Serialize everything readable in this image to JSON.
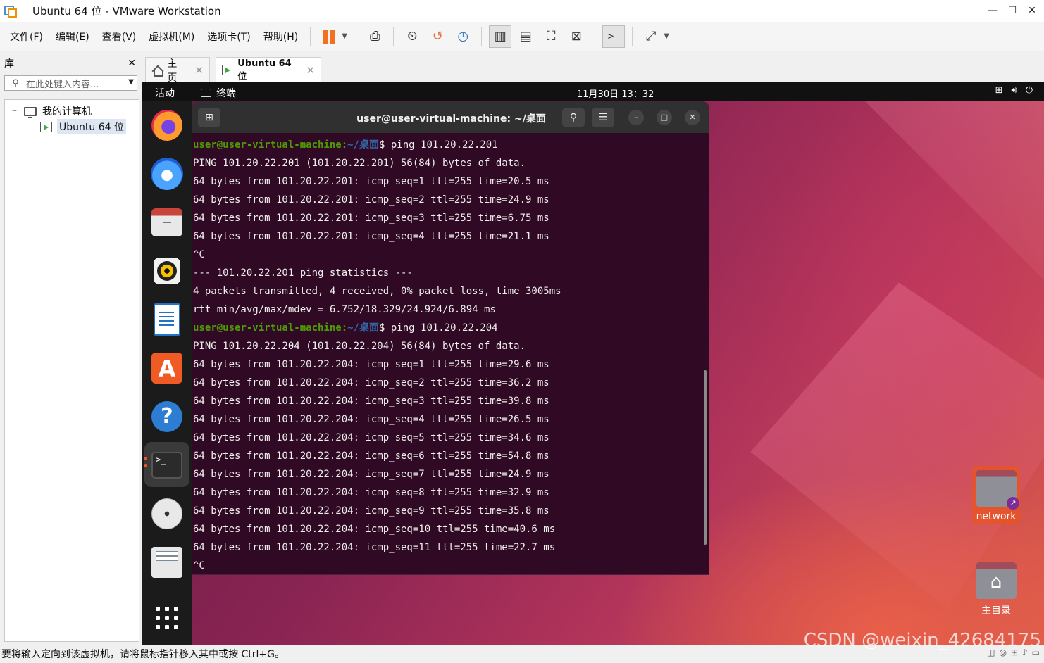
{
  "window": {
    "title": "Ubuntu 64 位 - VMware Workstation"
  },
  "menu": [
    "文件(F)",
    "编辑(E)",
    "查看(V)",
    "虚拟机(M)",
    "选项卡(T)",
    "帮助(H)"
  ],
  "toolbar_icons": [
    "pause-icon",
    "send-keys-icon",
    "snapshot-icon",
    "revert-snapshot-icon",
    "snapshot-manager-icon",
    "library-view-icon",
    "single-view-icon",
    "fullscreen-icon",
    "unity-icon",
    "console-icon",
    "stretch-icon"
  ],
  "library": {
    "title": "库",
    "search_placeholder": "在此处键入内容...",
    "tree": {
      "root": "我的计算机",
      "vm": "Ubuntu 64 位"
    }
  },
  "tabs": [
    {
      "label": "主页"
    },
    {
      "label": "Ubuntu 64 位",
      "active": true
    }
  ],
  "guest": {
    "topbar": {
      "activities": "活动",
      "app": "终端",
      "clock": "11月30日 13：32"
    },
    "dock": [
      "firefox-icon",
      "thunderbird-icon",
      "files-icon",
      "rhythmbox-icon",
      "writer-icon",
      "software-icon",
      "help-icon",
      "terminal-icon",
      "disc-icon",
      "printer-icon",
      "app-grid-icon"
    ],
    "terminal": {
      "title": "user@user-virtual-machine: ~/桌面",
      "prompt_user": "user@user-virtual-machine",
      "prompt_path": "~/桌面",
      "lines": [
        {
          "prompt": true,
          "cmd": "$ ping 101.20.22.201"
        },
        {
          "text": "PING 101.20.22.201 (101.20.22.201) 56(84) bytes of data."
        },
        {
          "text": "64 bytes from 101.20.22.201: icmp_seq=1 ttl=255 time=20.5 ms"
        },
        {
          "text": "64 bytes from 101.20.22.201: icmp_seq=2 ttl=255 time=24.9 ms"
        },
        {
          "text": "64 bytes from 101.20.22.201: icmp_seq=3 ttl=255 time=6.75 ms"
        },
        {
          "text": "64 bytes from 101.20.22.201: icmp_seq=4 ttl=255 time=21.1 ms"
        },
        {
          "text": "^C"
        },
        {
          "text": "--- 101.20.22.201 ping statistics ---"
        },
        {
          "text": "4 packets transmitted, 4 received, 0% packet loss, time 3005ms"
        },
        {
          "text": "rtt min/avg/max/mdev = 6.752/18.329/24.924/6.894 ms"
        },
        {
          "prompt": true,
          "cmd": "$ ping 101.20.22.204"
        },
        {
          "text": "PING 101.20.22.204 (101.20.22.204) 56(84) bytes of data."
        },
        {
          "text": "64 bytes from 101.20.22.204: icmp_seq=1 ttl=255 time=29.6 ms"
        },
        {
          "text": "64 bytes from 101.20.22.204: icmp_seq=2 ttl=255 time=36.2 ms"
        },
        {
          "text": "64 bytes from 101.20.22.204: icmp_seq=3 ttl=255 time=39.8 ms"
        },
        {
          "text": "64 bytes from 101.20.22.204: icmp_seq=4 ttl=255 time=26.5 ms"
        },
        {
          "text": "64 bytes from 101.20.22.204: icmp_seq=5 ttl=255 time=34.6 ms"
        },
        {
          "text": "64 bytes from 101.20.22.204: icmp_seq=6 ttl=255 time=54.8 ms"
        },
        {
          "text": "64 bytes from 101.20.22.204: icmp_seq=7 ttl=255 time=24.9 ms"
        },
        {
          "text": "64 bytes from 101.20.22.204: icmp_seq=8 ttl=255 time=32.9 ms"
        },
        {
          "text": "64 bytes from 101.20.22.204: icmp_seq=9 ttl=255 time=35.8 ms"
        },
        {
          "text": "64 bytes from 101.20.22.204: icmp_seq=10 ttl=255 time=40.6 ms"
        },
        {
          "text": "64 bytes from 101.20.22.204: icmp_seq=11 ttl=255 time=22.7 ms"
        },
        {
          "text": "^C"
        }
      ]
    },
    "desktop": {
      "network_label": "network",
      "home_label": "主目录"
    }
  },
  "status": {
    "message": "要将输入定向到该虚拟机，请将鼠标指针移入其中或按 Ctrl+G。"
  },
  "watermark": "CSDN @weixin_42684175",
  "colors": {
    "accent_orange": "#f37021",
    "terminal_bg": "#300a24",
    "prompt_user": "#4e9a06",
    "prompt_path": "#3465a4"
  }
}
